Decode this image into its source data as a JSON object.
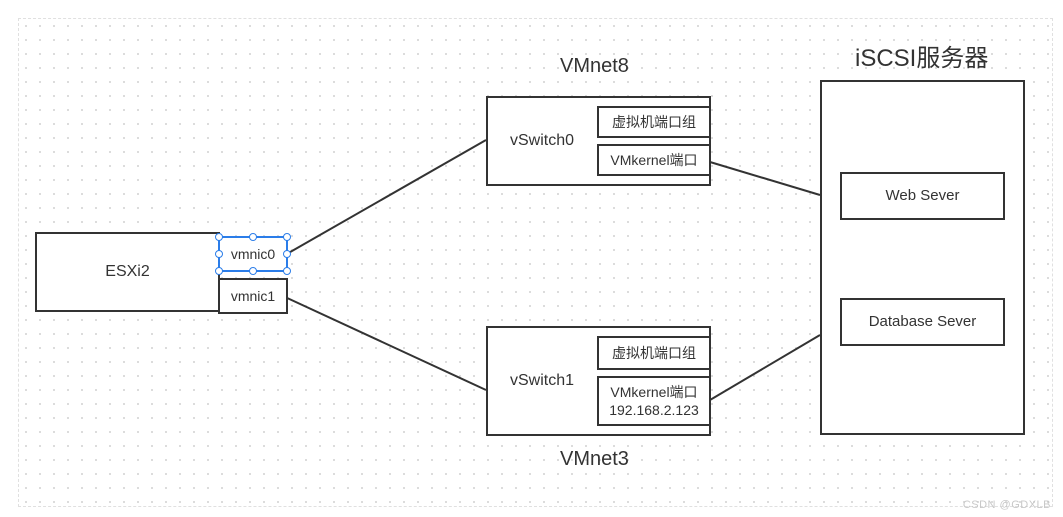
{
  "title_server": "iSCSI服务器",
  "title_vmnet8": "VMnet8",
  "title_vmnet3": "VMnet3",
  "esxi": {
    "label": "ESXi2"
  },
  "nics": {
    "vmnic0": "vmnic0",
    "vmnic1": "vmnic1"
  },
  "vswitch0": {
    "label": "vSwitch0",
    "portgroup": "虚拟机端口组",
    "vmkernel": "VMkernel端口"
  },
  "vswitch1": {
    "label": "vSwitch1",
    "portgroup": "虚拟机端口组",
    "vmkernel": "VMkernel端口\n192.168.2.123"
  },
  "server": {
    "web": "Web Sever",
    "db": "Database Sever"
  },
  "watermark": "CSDN @GDXLB"
}
